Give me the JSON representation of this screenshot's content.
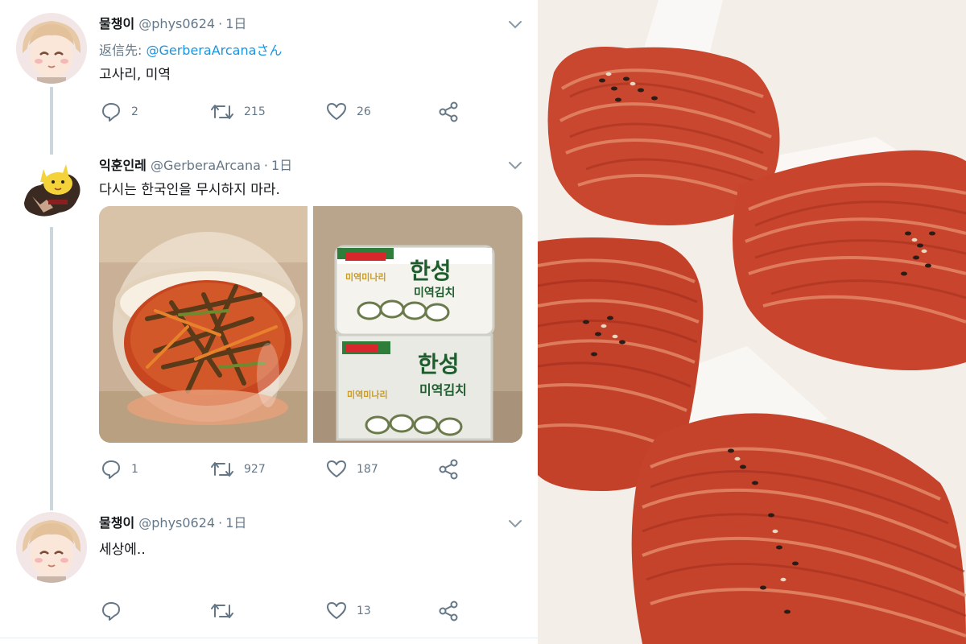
{
  "tweets": [
    {
      "name": "물챙이",
      "handle": "@phys0624",
      "time": "1日",
      "reply_prefix": "返信先: ",
      "reply_mention": "@GerberaArcanaさん",
      "text": "고사리, 미역",
      "counts": {
        "reply": "2",
        "retweet": "215",
        "like": "26"
      }
    },
    {
      "name": "익훈인레",
      "handle": "@GerberaArcana",
      "time": "1日",
      "text": "다시는 한국인을 무시하지 마라.",
      "counts": {
        "reply": "1",
        "retweet": "927",
        "like": "187"
      },
      "media_right_brand": "한성",
      "media_right_product": "미역김치",
      "media_right_tag": "미역미나리"
    },
    {
      "name": "물챙이",
      "handle": "@phys0624",
      "time": "1日",
      "text": "세상에..",
      "counts": {
        "like": "13"
      }
    }
  ],
  "icons": [
    "reply-icon",
    "retweet-icon",
    "like-icon",
    "share-icon",
    "chevron-down-icon"
  ],
  "colors": {
    "text": "#14171a",
    "secondary": "#657786",
    "mention": "#1b95e0",
    "thread_line": "#ccd6dd"
  }
}
